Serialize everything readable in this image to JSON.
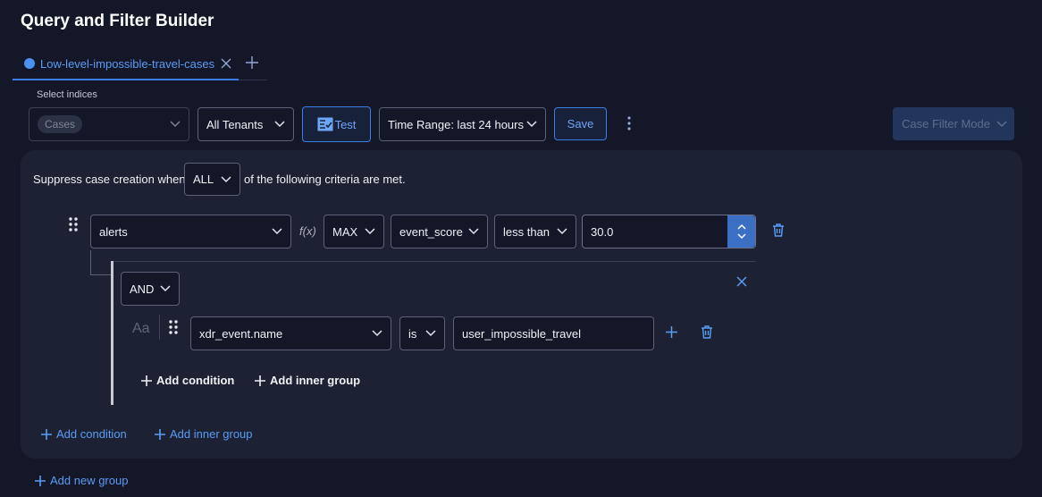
{
  "header": {
    "title": "Query and Filter Builder"
  },
  "tabs": {
    "active_label": "Low-level-impossible-travel-cases"
  },
  "toolbar": {
    "select_indices_label": "Select indices",
    "indices_chip": "Cases",
    "tenants_value": "All Tenants",
    "test_label": "Test",
    "time_range_value": "Time Range: last 24 hours",
    "save_label": "Save",
    "case_filter_mode_label": "Case Filter Mode"
  },
  "criteria": {
    "prefix": "Suppress case creation when",
    "match_value": "ALL",
    "suffix": "of the following criteria are met."
  },
  "condition1": {
    "field": "alerts",
    "function_label": "f(x)",
    "aggregation": "MAX",
    "attribute": "event_score",
    "operator": "less than",
    "value": "30.0"
  },
  "inner_group": {
    "logic": "AND",
    "aa_label": "Aa",
    "condition": {
      "field": "xdr_event.name",
      "operator": "is",
      "value": "user_impossible_travel"
    },
    "add_condition": "Add condition",
    "add_inner_group": "Add inner group"
  },
  "outer_group": {
    "add_condition": "Add condition",
    "add_inner_group": "Add inner group"
  },
  "add_new_group": "Add new group",
  "colors": {
    "accent": "#3b7fe6",
    "panel": "#1c2133",
    "background": "#131728"
  }
}
